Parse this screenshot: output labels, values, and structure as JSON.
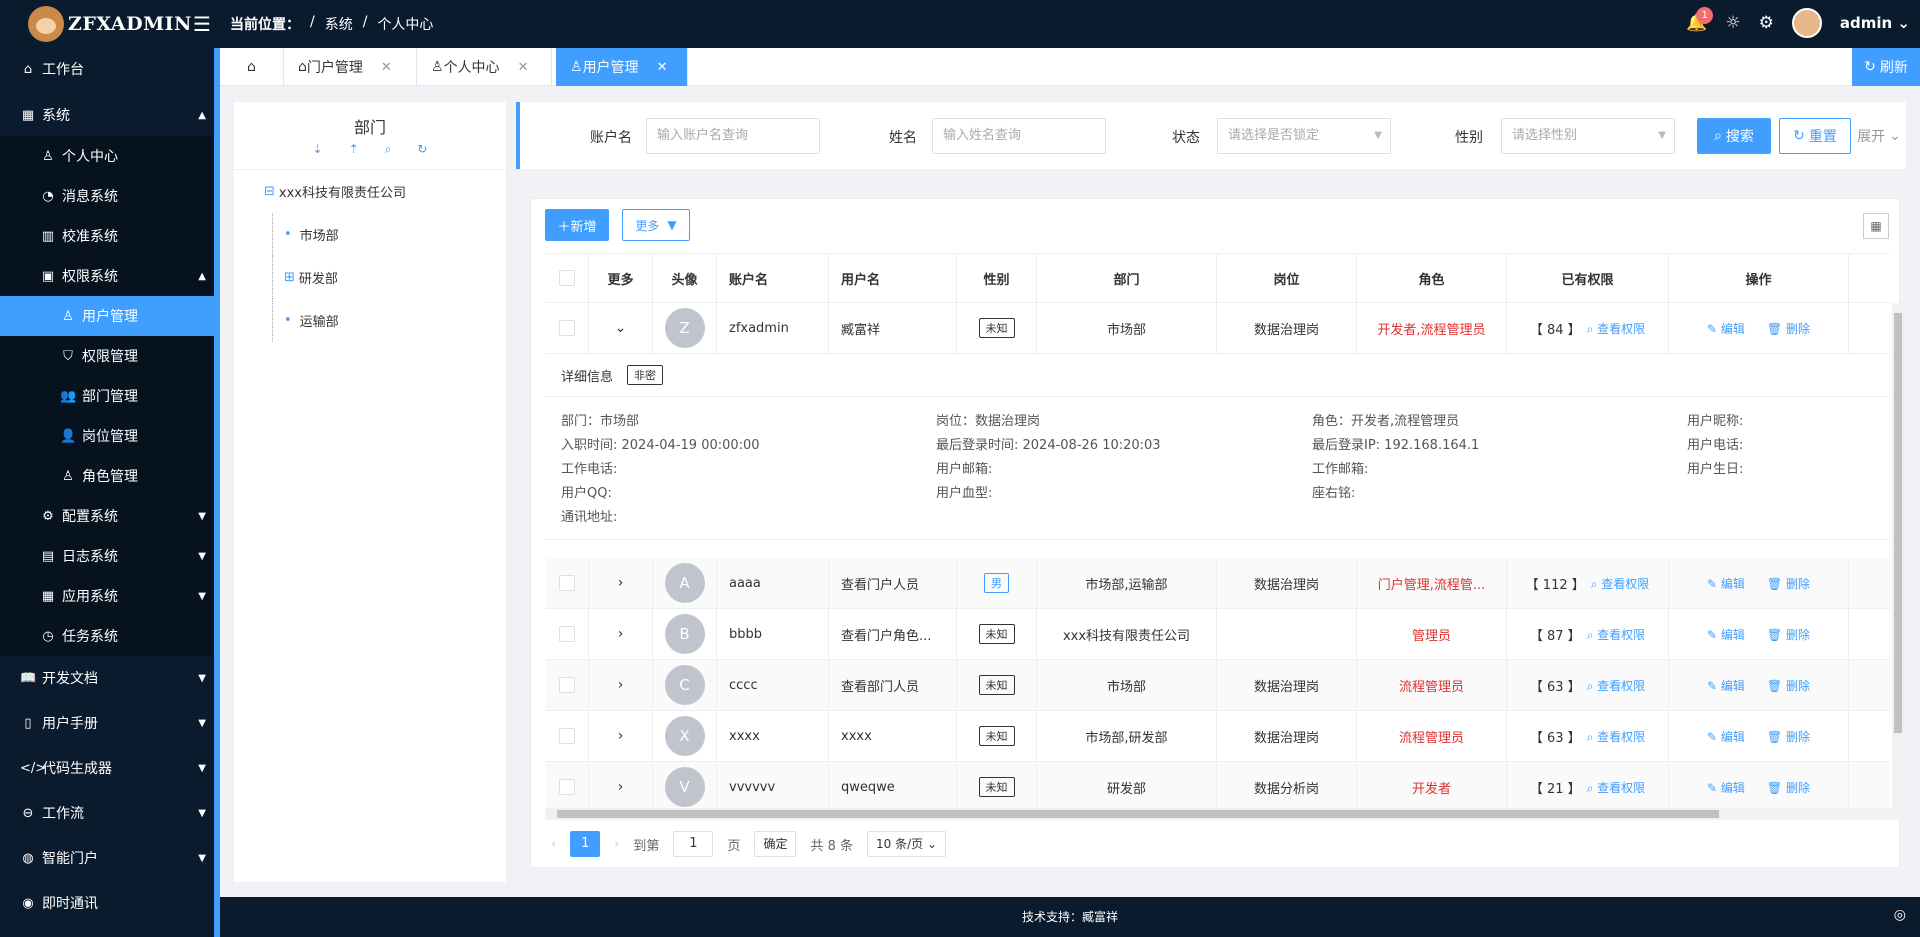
{
  "app": {
    "logo": "ZFXADMIN"
  },
  "breadcrumb": {
    "label": "当前位置：",
    "items": [
      "/",
      "系统",
      "/",
      "个人中心"
    ]
  },
  "topbar": {
    "notify_count": "1",
    "user": "admin"
  },
  "sidebar": {
    "items": [
      {
        "label": "工作台",
        "icon": "home-icon"
      },
      {
        "label": "系统",
        "icon": "grid-icon"
      },
      {
        "label": "个人中心",
        "icon": "user-icon"
      },
      {
        "label": "消息系统",
        "icon": "bell-icon"
      },
      {
        "label": "校准系统",
        "icon": "columns-icon"
      },
      {
        "label": "权限系统",
        "icon": "lock-icon"
      },
      {
        "label": "用户管理",
        "icon": "user-icon"
      },
      {
        "label": "权限管理",
        "icon": "shield-icon"
      },
      {
        "label": "部门管理",
        "icon": "users-icon"
      },
      {
        "label": "岗位管理",
        "icon": "person-icon"
      },
      {
        "label": "角色管理",
        "icon": "role-icon"
      },
      {
        "label": "配置系统",
        "icon": "gear-icon"
      },
      {
        "label": "日志系统",
        "icon": "table-icon"
      },
      {
        "label": "应用系统",
        "icon": "apps-icon"
      },
      {
        "label": "任务系统",
        "icon": "clock-icon"
      },
      {
        "label": "开发文档",
        "icon": "book-icon"
      },
      {
        "label": "用户手册",
        "icon": "doc-icon"
      },
      {
        "label": "代码生成器",
        "icon": "code-icon"
      },
      {
        "label": "工作流",
        "icon": "flow-icon"
      },
      {
        "label": "智能门户",
        "icon": "globe-icon"
      },
      {
        "label": "即时通讯",
        "icon": "chat-icon"
      }
    ]
  },
  "tabs": [
    {
      "label": "门户管理"
    },
    {
      "label": "个人中心"
    },
    {
      "label": "用户管理"
    }
  ],
  "refresh_label": "刷新",
  "dept": {
    "title": "部门",
    "tree": [
      "xxx科技有限责任公司",
      "市场部",
      "研发部",
      "运输部"
    ]
  },
  "search": {
    "account_label": "账户名",
    "account_ph": "输入账户名查询",
    "name_label": "姓名",
    "name_ph": "输入姓名查询",
    "status_label": "状态",
    "status_ph": "请选择是否锁定",
    "sex_label": "性别",
    "sex_ph": "请选择性别",
    "search_btn": "搜索",
    "reset_btn": "重置",
    "expand": "展开"
  },
  "toolbar": {
    "add": "新增",
    "more": "更多"
  },
  "table": {
    "headers": [
      "更多",
      "头像",
      "账户名",
      "用户名",
      "性别",
      "部门",
      "岗位",
      "角色",
      "已有权限",
      "操作"
    ],
    "view_perm": "查看权限",
    "edit": "编辑",
    "delete": "删除",
    "rows": [
      {
        "avatar": "Z",
        "account": "zfxadmin",
        "name": "臧富祥",
        "sex": "未知",
        "dept": "市场部",
        "post": "数据治理岗",
        "role": "开发者,流程管理员",
        "perm": "【 84 】"
      },
      {
        "avatar": "A",
        "account": "aaaa",
        "name": "查看门户人员",
        "sex": "男",
        "dept": "市场部,运输部",
        "post": "数据治理岗",
        "role": "门户管理,流程管...",
        "perm": "【 112 】"
      },
      {
        "avatar": "B",
        "account": "bbbb",
        "name": "查看门户角色...",
        "sex": "未知",
        "dept": "xxx科技有限责任公司",
        "post": "",
        "role": "管理员",
        "perm": "【 87 】"
      },
      {
        "avatar": "C",
        "account": "cccc",
        "name": "查看部门人员",
        "sex": "未知",
        "dept": "市场部",
        "post": "数据治理岗",
        "role": "流程管理员",
        "perm": "【 63 】"
      },
      {
        "avatar": "X",
        "account": "xxxx",
        "name": "xxxx",
        "sex": "未知",
        "dept": "市场部,研发部",
        "post": "数据治理岗",
        "role": "流程管理员",
        "perm": "【 63 】"
      },
      {
        "avatar": "V",
        "account": "vvvvvv",
        "name": "qweqwe",
        "sex": "未知",
        "dept": "研发部",
        "post": "数据分析岗",
        "role": "开发者",
        "perm": "【 21 】"
      }
    ]
  },
  "detail": {
    "title": "详细信息",
    "fold": "非密",
    "col1": [
      "部门：市场部",
      "入职时间:   2024-04-19 00:00:00",
      "工作电话:",
      "用户QQ:",
      "通讯地址:"
    ],
    "col2": [
      "岗位：数据治理岗",
      "最后登录时间:   2024-08-26 10:20:03",
      "用户邮箱:",
      "用户血型:"
    ],
    "col3": [
      "角色：开发者,流程管理员",
      "最后登录IP:   192.168.164.1",
      "工作邮箱:",
      "座右铭:"
    ],
    "col4": [
      "用户昵称:",
      "用户电话:",
      "用户生日:"
    ]
  },
  "pager": {
    "current": "1",
    "goto": "到第",
    "page_val": "1",
    "page": "页",
    "ok": "确定",
    "total": "共 8 条",
    "size": "10 条/页"
  },
  "footer": "技术支持：臧富祥"
}
